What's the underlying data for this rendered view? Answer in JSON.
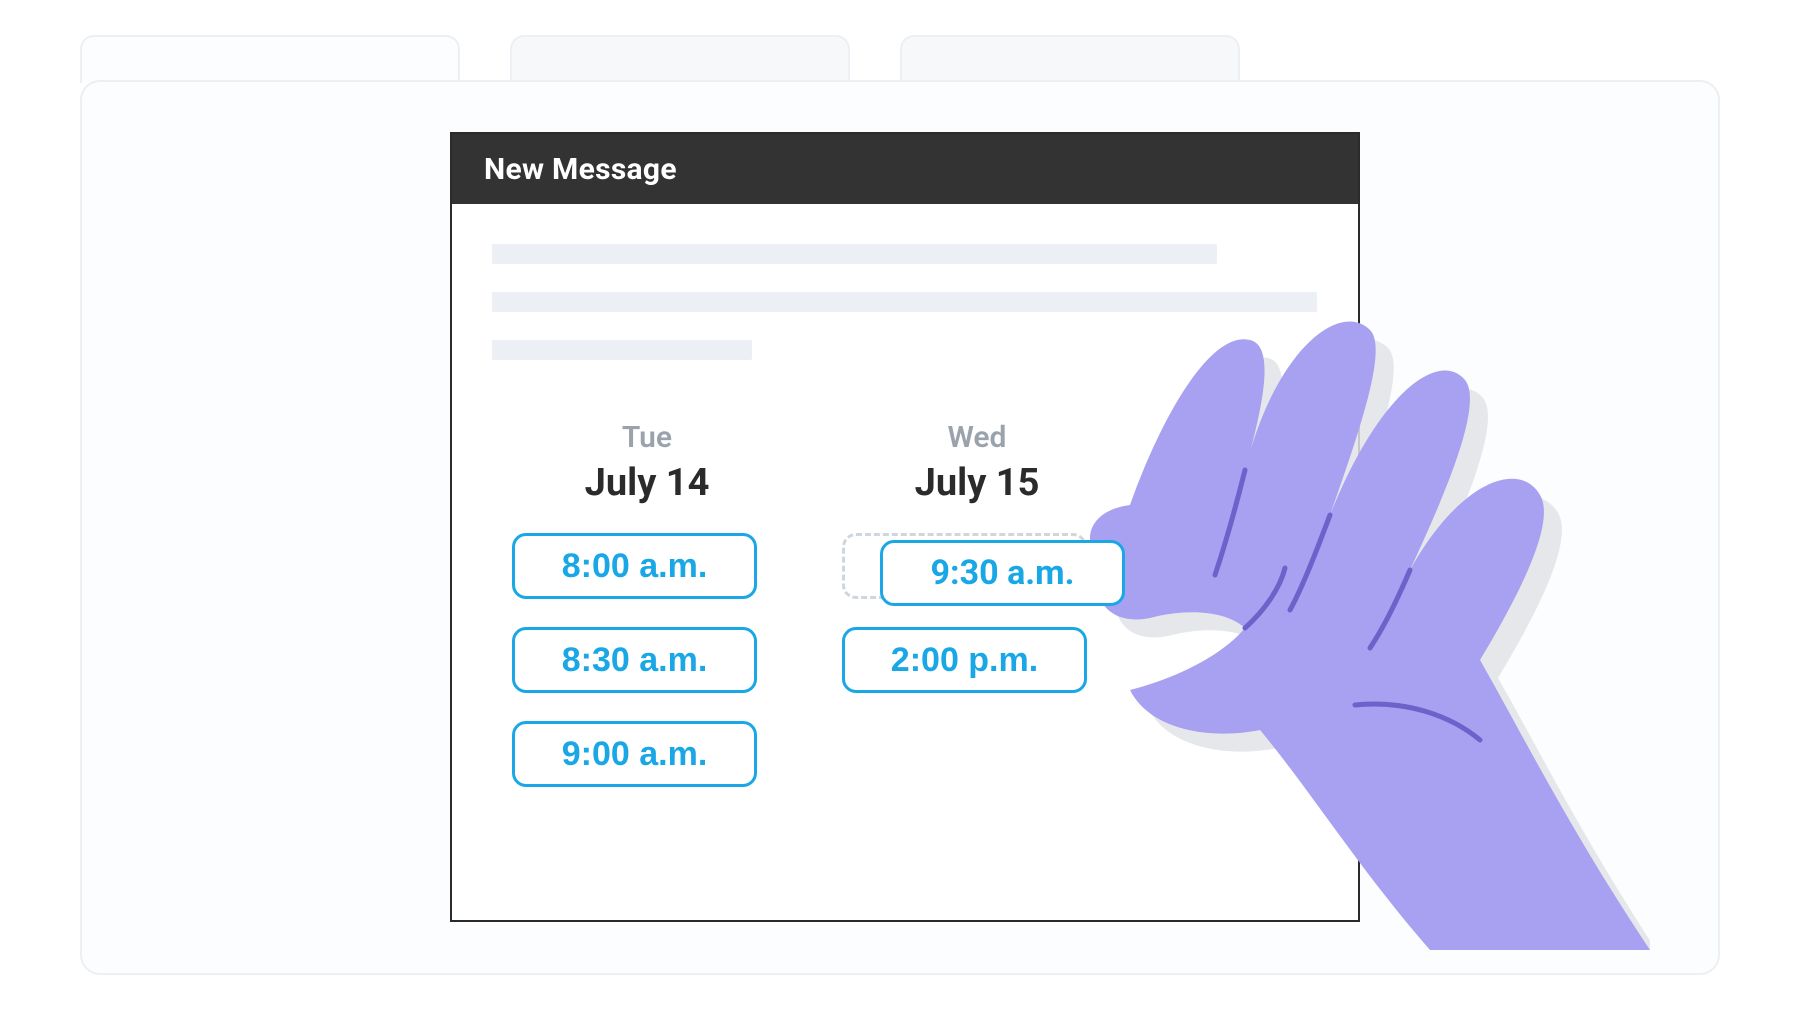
{
  "window": {
    "title": "New Message"
  },
  "schedule": {
    "columns": [
      {
        "dow": "Tue",
        "date": "July 14",
        "slots": [
          "8:00 a.m.",
          "8:30 a.m.",
          "9:00 a.m."
        ]
      },
      {
        "dow": "Wed",
        "date": "July 15",
        "slots": [
          "2:00 p.m."
        ],
        "dragged_slot": "9:30 a.m."
      }
    ]
  },
  "colors": {
    "accent": "#19a7e6",
    "glove": "#a8a0f0",
    "titlebar": "#333333",
    "placeholder": "#eceff3"
  }
}
